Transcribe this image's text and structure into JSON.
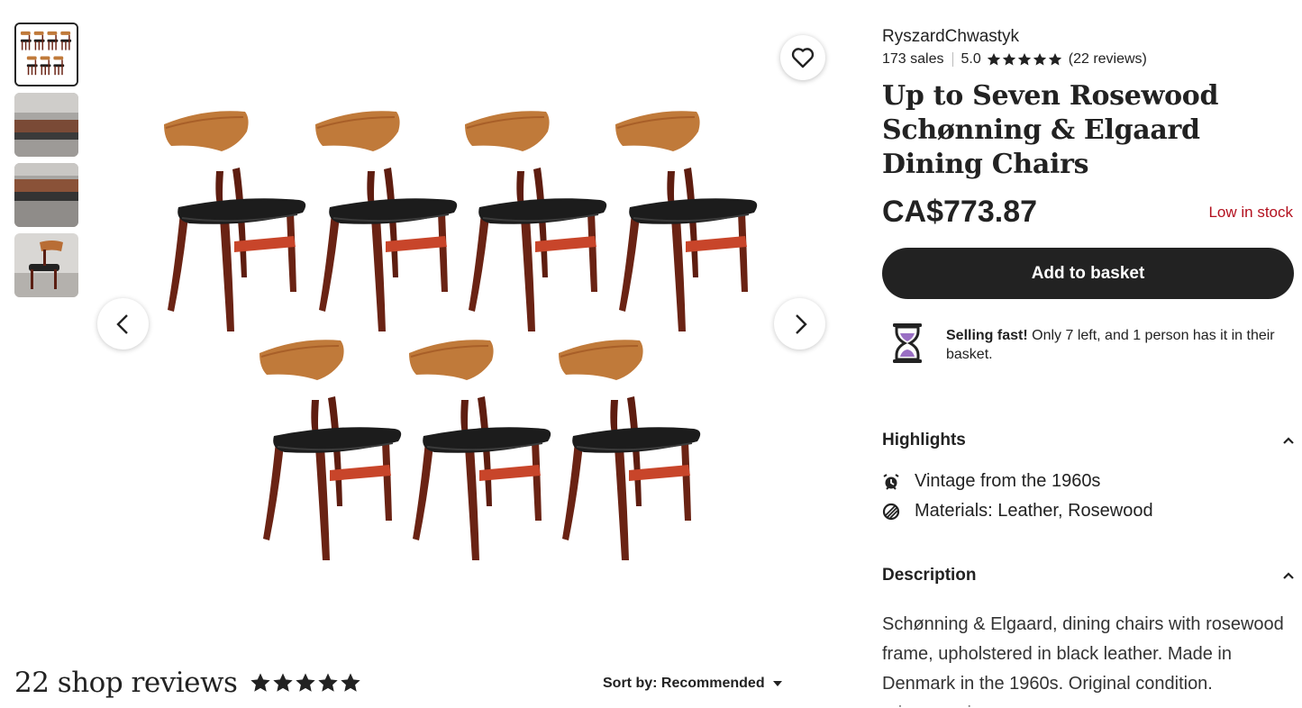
{
  "gallery": {
    "thumbnails": [
      {
        "name": "thumbnail-1",
        "active": true
      },
      {
        "name": "thumbnail-2",
        "active": false
      },
      {
        "name": "thumbnail-3",
        "active": false
      },
      {
        "name": "thumbnail-4",
        "active": false
      }
    ],
    "favorite_icon": "heart-icon",
    "prev_icon": "chevron-left-icon",
    "next_icon": "chevron-right-icon"
  },
  "shop": {
    "name": "RyszardChwastyk",
    "sales": "173 sales",
    "rating": "5.0",
    "reviews": "(22 reviews)"
  },
  "product": {
    "title": "Up to Seven Rosewood Schønning & Elgaard Dining Chairs",
    "price": "CA$773.87",
    "stock": "Low in stock",
    "add_to_basket": "Add to basket"
  },
  "selling_fast": {
    "bold": "Selling fast!",
    "text": " Only 7 left, and 1 person has it in their basket."
  },
  "highlights": {
    "heading": "Highlights",
    "items": [
      {
        "icon": "alarm-clock-icon",
        "label": "Vintage from the 1960s"
      },
      {
        "icon": "materials-icon",
        "label": "Materials: Leather, Rosewood"
      }
    ]
  },
  "description": {
    "heading": "Description",
    "text": "Schønning & Elgaard, dining chairs with rosewood frame, upholstered in black leather. Made in Denmark in the 1960s. Original condition.",
    "fade": "price per piece"
  },
  "reviews_section": {
    "heading": "22 shop reviews",
    "sort_label": "Sort by: Recommended"
  },
  "colors": {
    "accent": "#222222",
    "stock_red": "#b3101e",
    "hourglass_purple": "#9a6fc4",
    "teak": "#c07a3a",
    "rosewood": "#6a2314",
    "leather": "#1c1c1c"
  }
}
